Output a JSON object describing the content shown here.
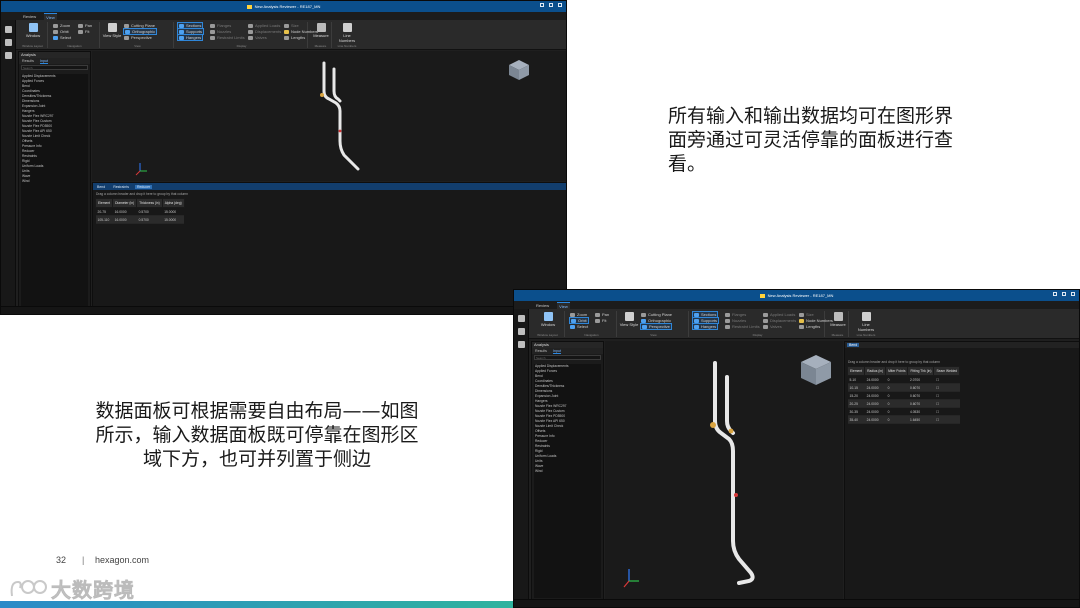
{
  "window_title": "New Analysis Reviewer - RE187_MN",
  "menu": [
    "Review",
    "View"
  ],
  "menu_active": "View",
  "ribbon": {
    "window_layout": "Window",
    "window_layout_cap": "Window Layout",
    "nav_items": [
      "Zoom",
      "Pan",
      "Orbit",
      "Fit",
      "Select"
    ],
    "nav_cap": "Navigation",
    "view_style": "View Style",
    "view_items": [
      "Cutting Plane",
      "Orthographic",
      "Perspective"
    ],
    "view_cap": "View",
    "display_items": [
      "Sections",
      "Supports",
      "Hangers",
      "Flanges",
      "Nozzles",
      "Restraint Limits",
      "Applied Loads",
      "Displacements",
      "Valves",
      "Size",
      "Node Numbers",
      "Lengths"
    ],
    "display_cap": "Display",
    "measure": "Measure",
    "measure_cap": "Measure",
    "line_numbers": "Line Numbers",
    "line_numbers_cap": "Line Numbers"
  },
  "left_panel": {
    "title": "Analysis",
    "tabs": [
      "Results",
      "Input"
    ],
    "active_tab": "Input",
    "search_placeholder": "Search",
    "items": [
      "Applied Displacements",
      "Applied Forces",
      "Bend",
      "Coordinates",
      "Densities/Thickness",
      "Dimensions",
      "Expansion Joint",
      "Hangers",
      "Nozzle Flex WRC297",
      "Nozzle Flex Custom",
      "Nozzle Flex PD5500",
      "Nozzle Flex API 650",
      "Nozzle Limit Check",
      "Offsets",
      "Pressure Info",
      "Reducer",
      "Restraints",
      "Rigid",
      "Uniform Loads",
      "Units",
      "Wave",
      "Wind"
    ]
  },
  "shot1": {
    "doc_tabs": [
      "Bend",
      "Restraints",
      "Reducer"
    ],
    "doc_active": "Reducer",
    "group_hint": "Drag a column header and drop it here to group by that column",
    "columns": [
      "Element",
      "Diameter (in)",
      "Thickness (in)",
      "Alpha (deg)"
    ],
    "rows": [
      [
        "20-75",
        "16.0000",
        "0.5700",
        "15.0000"
      ],
      [
        "105-110",
        "16.0000",
        "0.5700",
        "15.0000"
      ]
    ]
  },
  "shot2": {
    "doc_tabs": [
      "Bend"
    ],
    "doc_active": "Bend",
    "group_hint": "Drag a column header and drop it here to group by that column",
    "columns": [
      "Element",
      "Radius (in)",
      "Miter Points",
      "Fitting Thk (in)",
      "Seam Welded"
    ],
    "rows": [
      [
        "5-10",
        "24.0000",
        "0",
        "2.0700",
        "☐"
      ],
      [
        "10-15",
        "24.0000",
        "0",
        "0.6070",
        "☐"
      ],
      [
        "15-20",
        "24.0000",
        "0",
        "0.6070",
        "☐"
      ],
      [
        "20-25",
        "24.0000",
        "0",
        "0.6070",
        "☐"
      ],
      [
        "30-35",
        "24.0000",
        "0",
        "4.0530",
        "☐"
      ],
      [
        "35-40",
        "24.0000",
        "0",
        "1.6450",
        "☐"
      ]
    ]
  },
  "caption_top": "所有输入和输出数据均可在图形界面旁通过可灵活停靠的面板进行查看。",
  "caption_bottom": "数据面板可根据需要自由布局——如图所示，输入数据面板既可停靠在图形区域下方，也可并列置于侧边",
  "page_number": "32",
  "separator": "|",
  "website": "hexagon.com",
  "watermark": "大数跨境",
  "colors": {
    "titlebar": "#0b4f8c",
    "accent": "#2c88e0",
    "pipe": "#e8e8e8"
  }
}
